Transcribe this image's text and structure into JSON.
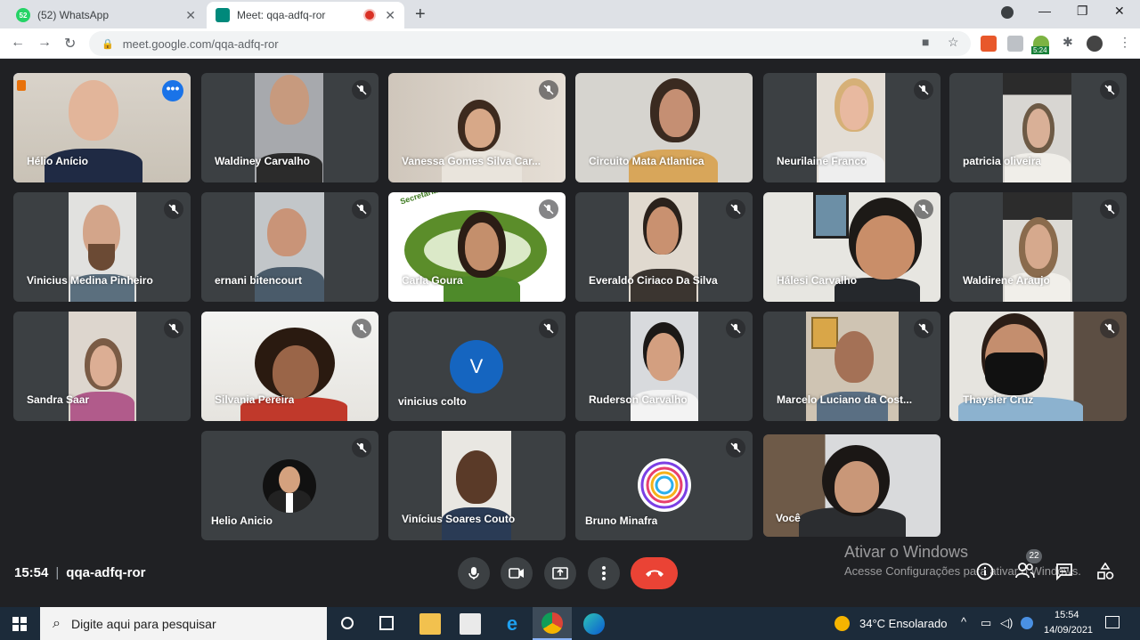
{
  "browser": {
    "tabs": [
      {
        "title": "(52) WhatsApp",
        "badge": "52"
      },
      {
        "title": "Meet: qqa-adfq-ror"
      }
    ],
    "url": "meet.google.com/qqa-adfq-ror",
    "extension_badge": "5:24"
  },
  "participants": [
    {
      "name": "Hélio Anício"
    },
    {
      "name": "Waldiney Carvalho"
    },
    {
      "name": "Vanessa Gomes Silva Car..."
    },
    {
      "name": "Circuito Mata Atlantica"
    },
    {
      "name": "Neurilaine Franco"
    },
    {
      "name": "patricia oliveira"
    },
    {
      "name": "Vinicius Medina Pinheiro"
    },
    {
      "name": "ernani bitencourt"
    },
    {
      "name": "Carla Goura",
      "banner": "Secretaria de Meio Ambiente e Turismo"
    },
    {
      "name": "Everaldo Ciriaco Da Silva"
    },
    {
      "name": "Hálesi Carvalho"
    },
    {
      "name": "Waldirene Araujo"
    },
    {
      "name": "Sandra Saar"
    },
    {
      "name": "Silvania Pereira"
    },
    {
      "name": "vinicius colto",
      "initial": "V"
    },
    {
      "name": "Ruderson Carvalho"
    },
    {
      "name": "Marcelo Luciano da Cost..."
    },
    {
      "name": "Thaysler Cruz"
    },
    {
      "name": "Helio Anicio"
    },
    {
      "name": "Vinícius Soares Couto"
    },
    {
      "name": "Bruno Minafra"
    },
    {
      "name": "Você"
    }
  ],
  "meeting": {
    "time": "15:54",
    "code": "qqa-adfq-ror",
    "participant_count": "22"
  },
  "watermark": {
    "line1": "Ativar o Windows",
    "line2": "Acesse Configurações para ativar o Windows."
  },
  "taskbar": {
    "search_placeholder": "Digite aqui para pesquisar",
    "weather": "34°C  Ensolarado",
    "clock_time": "15:54",
    "clock_date": "14/09/2021"
  },
  "colors": {
    "meet_background": "#202124",
    "tile_background": "#3c4043",
    "hangup_red": "#ea4335",
    "active_speaker_outline": "#8ab4f8",
    "avatar_v_blue": "#1565c0"
  }
}
